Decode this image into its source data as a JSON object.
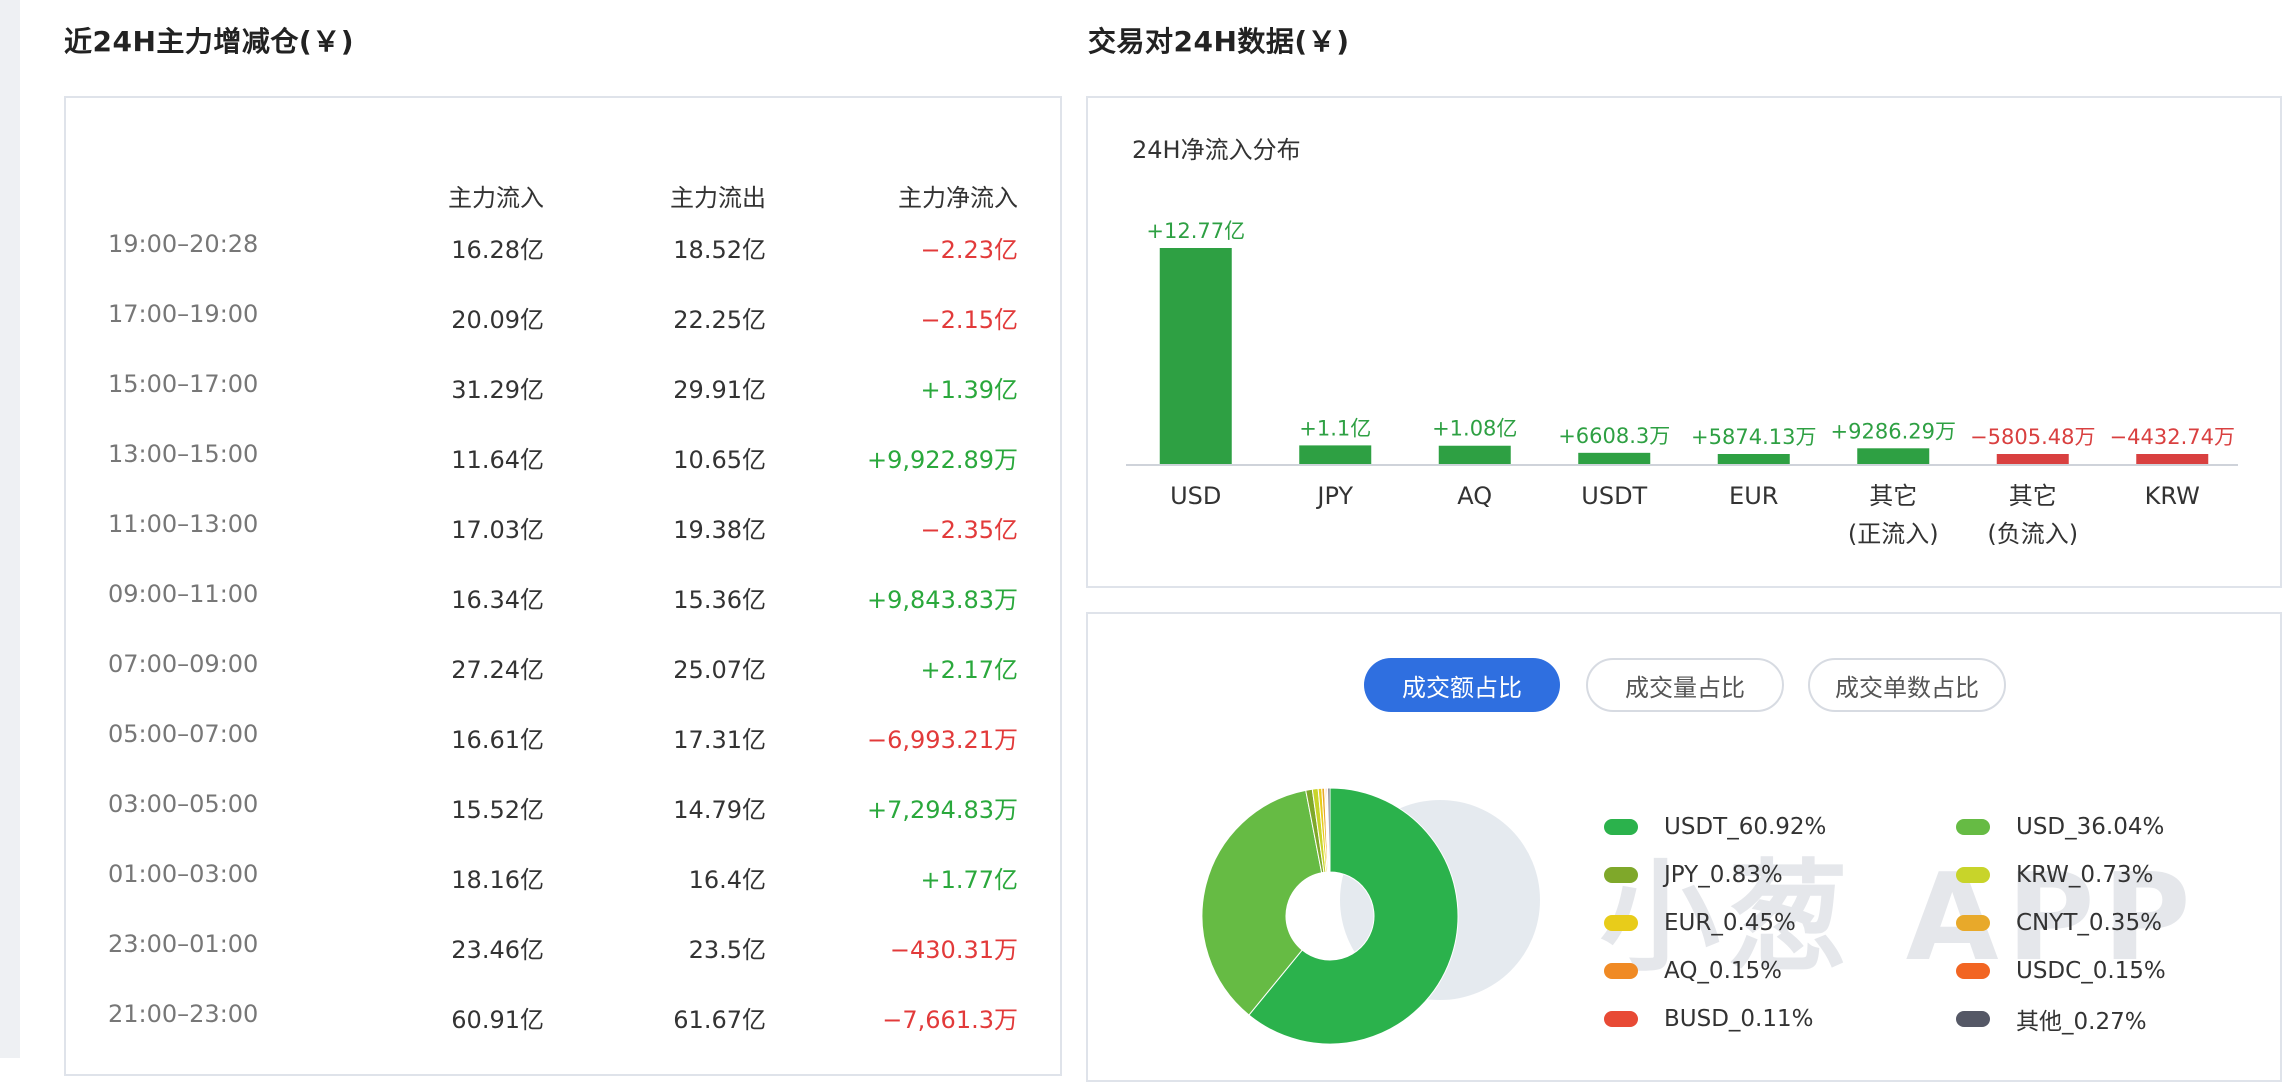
{
  "left": {
    "title": "近24H主力增减仓(￥)",
    "headers": [
      "",
      "主力流入",
      "主力流出",
      "主力净流入"
    ],
    "rows": [
      {
        "time": "19:00–20:28",
        "inflow": "16.28亿",
        "outflow": "18.52亿",
        "net": "−2.23亿",
        "sign": "neg"
      },
      {
        "time": "17:00–19:00",
        "inflow": "20.09亿",
        "outflow": "22.25亿",
        "net": "−2.15亿",
        "sign": "neg"
      },
      {
        "time": "15:00–17:00",
        "inflow": "31.29亿",
        "outflow": "29.91亿",
        "net": "+1.39亿",
        "sign": "pos"
      },
      {
        "time": "13:00–15:00",
        "inflow": "11.64亿",
        "outflow": "10.65亿",
        "net": "+9,922.89万",
        "sign": "pos"
      },
      {
        "time": "11:00–13:00",
        "inflow": "17.03亿",
        "outflow": "19.38亿",
        "net": "−2.35亿",
        "sign": "neg"
      },
      {
        "time": "09:00–11:00",
        "inflow": "16.34亿",
        "outflow": "15.36亿",
        "net": "+9,843.83万",
        "sign": "pos"
      },
      {
        "time": "07:00–09:00",
        "inflow": "27.24亿",
        "outflow": "25.07亿",
        "net": "+2.17亿",
        "sign": "pos"
      },
      {
        "time": "05:00–07:00",
        "inflow": "16.61亿",
        "outflow": "17.31亿",
        "net": "−6,993.21万",
        "sign": "neg"
      },
      {
        "time": "03:00–05:00",
        "inflow": "15.52亿",
        "outflow": "14.79亿",
        "net": "+7,294.83万",
        "sign": "pos"
      },
      {
        "time": "01:00–03:00",
        "inflow": "18.16亿",
        "outflow": "16.4亿",
        "net": "+1.77亿",
        "sign": "pos"
      },
      {
        "time": "23:00–01:00",
        "inflow": "23.46亿",
        "outflow": "23.5亿",
        "net": "−430.31万",
        "sign": "neg"
      },
      {
        "time": "21:00–23:00",
        "inflow": "60.91亿",
        "outflow": "61.67亿",
        "net": "−7,661.3万",
        "sign": "neg"
      }
    ]
  },
  "right": {
    "title": "交易对24H数据(￥)"
  },
  "chart_data": [
    {
      "type": "bar",
      "title": "24H净流入分布",
      "categories": [
        "USD",
        "JPY",
        "AQ",
        "USDT",
        "EUR",
        "其它\n(正流入)",
        "其它\n(负流入)",
        "KRW"
      ],
      "values": [
        127700,
        11000,
        10800,
        6608.3,
        5874.13,
        9286.29,
        -5805.48,
        -4432.74
      ],
      "unit": "万",
      "labels": [
        "+12.77亿",
        "+1.1亿",
        "+1.08亿",
        "+6608.3万",
        "+5874.13万",
        "+9286.29万",
        "−5805.48万",
        "−4432.74万"
      ],
      "colors": {
        "positive": "#2ea043",
        "negative": "#d94040"
      }
    },
    {
      "type": "pie",
      "slices": [
        {
          "name": "USDT_60.92%",
          "value": 60.92,
          "color": "#2bb24c"
        },
        {
          "name": "USD_36.04%",
          "value": 36.04,
          "color": "#66bb44"
        },
        {
          "name": "JPY_0.83%",
          "value": 0.83,
          "color": "#7fa82a"
        },
        {
          "name": "KRW_0.73%",
          "value": 0.73,
          "color": "#c8d42a"
        },
        {
          "name": "EUR_0.45%",
          "value": 0.45,
          "color": "#e8cc1a"
        },
        {
          "name": "CNYT_0.35%",
          "value": 0.35,
          "color": "#e8a92a"
        },
        {
          "name": "AQ_0.15%",
          "value": 0.15,
          "color": "#f08a24"
        },
        {
          "name": "USDC_0.15%",
          "value": 0.15,
          "color": "#f26522"
        },
        {
          "name": "BUSD_0.11%",
          "value": 0.11,
          "color": "#e84a35"
        },
        {
          "name": "其他_0.27%",
          "value": 0.27,
          "color": "#555866"
        }
      ]
    }
  ],
  "tabs": [
    "成交额占比",
    "成交量占比",
    "成交单数占比"
  ],
  "watermark": "小葱 APP"
}
